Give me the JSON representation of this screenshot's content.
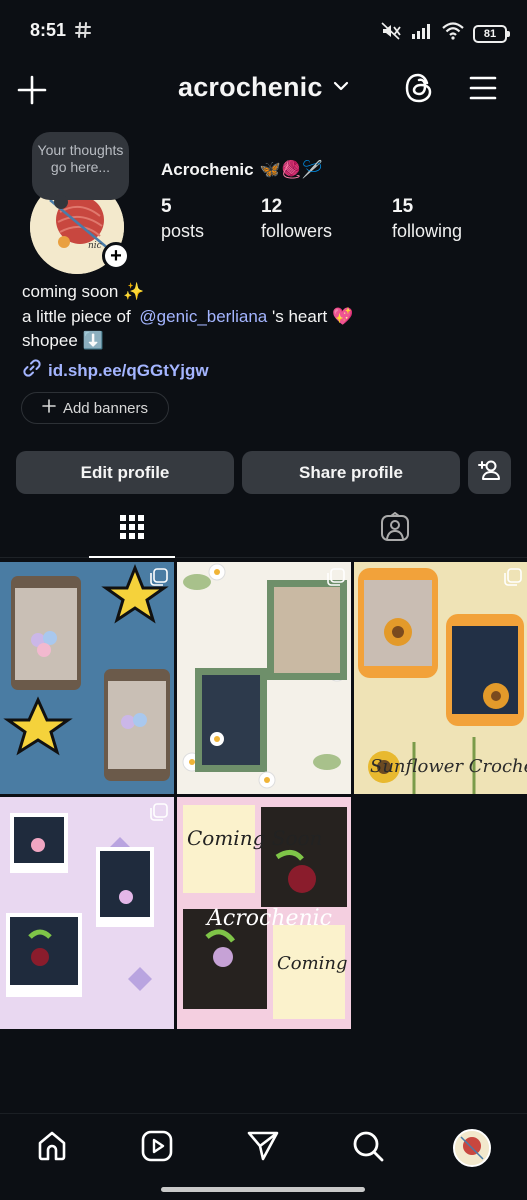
{
  "status_bar": {
    "time": "8:51",
    "battery": "81"
  },
  "header": {
    "username": "acrochenic"
  },
  "note": {
    "text": "Your thoughts go here..."
  },
  "profile": {
    "display_name": "Acrochenic",
    "display_name_emoji": "🦋🧶🪡",
    "stats": [
      {
        "count": "5",
        "label": "posts"
      },
      {
        "count": "12",
        "label": "followers"
      },
      {
        "count": "15",
        "label": "following"
      }
    ],
    "bio": {
      "line1": "coming soon ✨",
      "line2_prefix": "a little piece of",
      "line2_mention": "@genic_berliana",
      "line2_suffix": "'s heart 💖",
      "line3": "shopee ⬇️"
    },
    "link": "id.shp.ee/qGGtYjgw",
    "add_banners_label": "Add banners"
  },
  "actions": {
    "edit_label": "Edit profile",
    "share_label": "Share profile"
  },
  "grid_posts": [
    {
      "id": "post-1",
      "caption": ""
    },
    {
      "id": "post-2",
      "caption": ""
    },
    {
      "id": "post-3",
      "caption": "Sunflower Crochet"
    },
    {
      "id": "post-4",
      "caption": ""
    },
    {
      "id": "post-5",
      "caption_top": "Coming Soon",
      "caption_mid": "Acrochenic",
      "caption_bottom": "Coming Soon"
    }
  ],
  "colors": {
    "background": "#0c0f14",
    "button": "#363a40",
    "link": "#a4b5ff"
  }
}
